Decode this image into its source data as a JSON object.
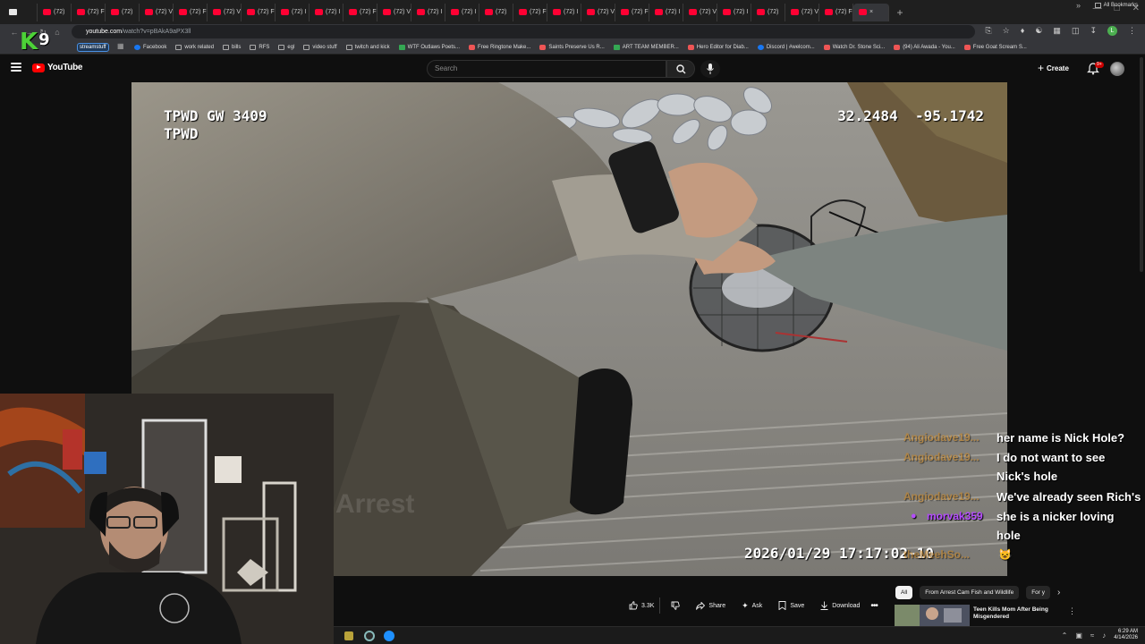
{
  "browser": {
    "tabs": [
      {
        "label": "(72)"
      },
      {
        "label": "(72) F"
      },
      {
        "label": "(72)"
      },
      {
        "label": "(72) V"
      },
      {
        "label": "(72) F"
      },
      {
        "label": "(72) V"
      },
      {
        "label": "(72) F"
      },
      {
        "label": "(72) I"
      },
      {
        "label": "(72) I"
      },
      {
        "label": "(72) F"
      },
      {
        "label": "(72) V"
      },
      {
        "label": "(72) I"
      },
      {
        "label": "(72) I"
      },
      {
        "label": "(72)"
      },
      {
        "label": "(72) F"
      },
      {
        "label": "(72) I"
      },
      {
        "label": "(72) V"
      },
      {
        "label": "(72) F"
      },
      {
        "label": "(72) I"
      },
      {
        "label": "(72) V"
      },
      {
        "label": "(72) I"
      },
      {
        "label": "(72)"
      },
      {
        "label": "(72) V"
      },
      {
        "label": "(72) F"
      }
    ],
    "url_host": "youtube.com",
    "url_path": "/watch?v=pBAkA9aPX3ll",
    "bookmarks": [
      {
        "label": "Facebook",
        "icon": "facebook-icon"
      },
      {
        "label": "work related",
        "icon": "folder-icon"
      },
      {
        "label": "bills",
        "icon": "folder-icon"
      },
      {
        "label": "RFS",
        "icon": "folder-icon"
      },
      {
        "label": "egl",
        "icon": "folder-icon"
      },
      {
        "label": "video stuff",
        "icon": "folder-icon"
      },
      {
        "label": "twitch and kick",
        "icon": "folder-icon"
      },
      {
        "label": "WTF Outlaws Poets...",
        "icon": "green-site-icon"
      },
      {
        "label": "Free Ringtone Make...",
        "icon": "site-icon"
      },
      {
        "label": "Saints Preserve Us R...",
        "icon": "site-icon"
      },
      {
        "label": "ART TEAM MEMBER...",
        "icon": "green-site-icon"
      },
      {
        "label": "Hero Editor for Diab...",
        "icon": "site-icon"
      },
      {
        "label": "Discord | #welcom...",
        "icon": "discord-icon"
      },
      {
        "label": "Watch Dr. Stone Sci...",
        "icon": "site-icon"
      },
      {
        "label": "(94) Ali Awada - You...",
        "icon": "youtube-icon"
      },
      {
        "label": "Free Goat Scream S...",
        "icon": "site-icon"
      }
    ],
    "all_bookmarks": "All Bookmarks",
    "streamstuff": "streamstuff",
    "profile_initial": "L"
  },
  "overlay_logo": {
    "k": "K",
    "nine": "9"
  },
  "youtube": {
    "logo_text": "YouTube",
    "search_placeholder": "Search",
    "create_label": "Create",
    "notif_badge": "9+"
  },
  "video": {
    "officer_line1": "TPWD GW 3409",
    "officer_line2": "TPWD",
    "gps_lat": "32.2484",
    "gps_lon": "-95.1742",
    "timestamp": "2026/01/29  17:17:02-10",
    "watermark": "Arrest"
  },
  "chat": [
    {
      "user": "Angiodave19...",
      "message": "her name is Nick Hole?",
      "verified": false
    },
    {
      "user": "Angiodave19...",
      "message": "I do not want to see",
      "verified": false
    },
    {
      "user": "",
      "message": "Nick's hole",
      "verified": false
    },
    {
      "user": "Angiodave19...",
      "message": "We've already seen Rich's",
      "verified": false
    },
    {
      "user": "morvak359",
      "message": "she is a nicker loving",
      "verified": true
    },
    {
      "user": "",
      "message": "hole",
      "verified": false
    },
    {
      "user": "theMeehSo...",
      "message": "",
      "verified": false
    }
  ],
  "actions": {
    "likes": "3.3K",
    "share": "Share",
    "ask": "Ask",
    "save": "Save",
    "download": "Download"
  },
  "recommend": {
    "chips": [
      "All",
      "From Arrest Cam Fish and Wildlife",
      "For y"
    ],
    "item_title": "Teen Kills Mom After Being Misgendered"
  },
  "taskbar": {
    "time": "6:29 AM",
    "date": "4/14/2026"
  },
  "colors": {
    "youtube_red": "#ff0000",
    "chat_username_orange": "#d48a1e",
    "chat_username_purple": "#b54cff",
    "k9_green": "#4cd137"
  }
}
